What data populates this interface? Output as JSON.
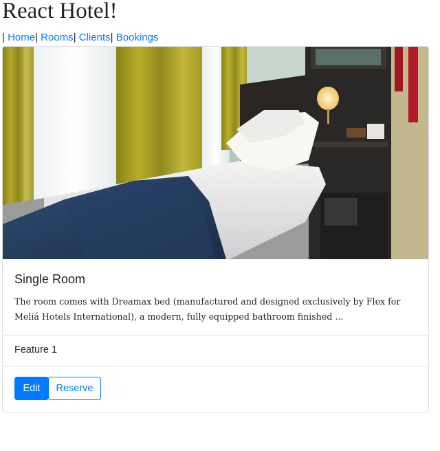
{
  "header": {
    "title": "React Hotel!"
  },
  "nav": {
    "separator": "|",
    "links": [
      "Home",
      "Rooms",
      "Clients",
      "Bookings"
    ]
  },
  "room_card": {
    "image_alt": "Single room with bed and nightstand",
    "title": "Single Room",
    "description": "The room comes with Dreamax bed (manufactured and designed exclusively by Flex for Meliá Hotels International), a modern, fully equipped bathroom finished ...",
    "features": [
      "Feature 1"
    ],
    "actions": {
      "edit_label": "Edit",
      "reserve_label": "Reserve"
    }
  },
  "colors": {
    "primary": "#007bff",
    "text": "#212529",
    "border": "#dfdfdf"
  }
}
